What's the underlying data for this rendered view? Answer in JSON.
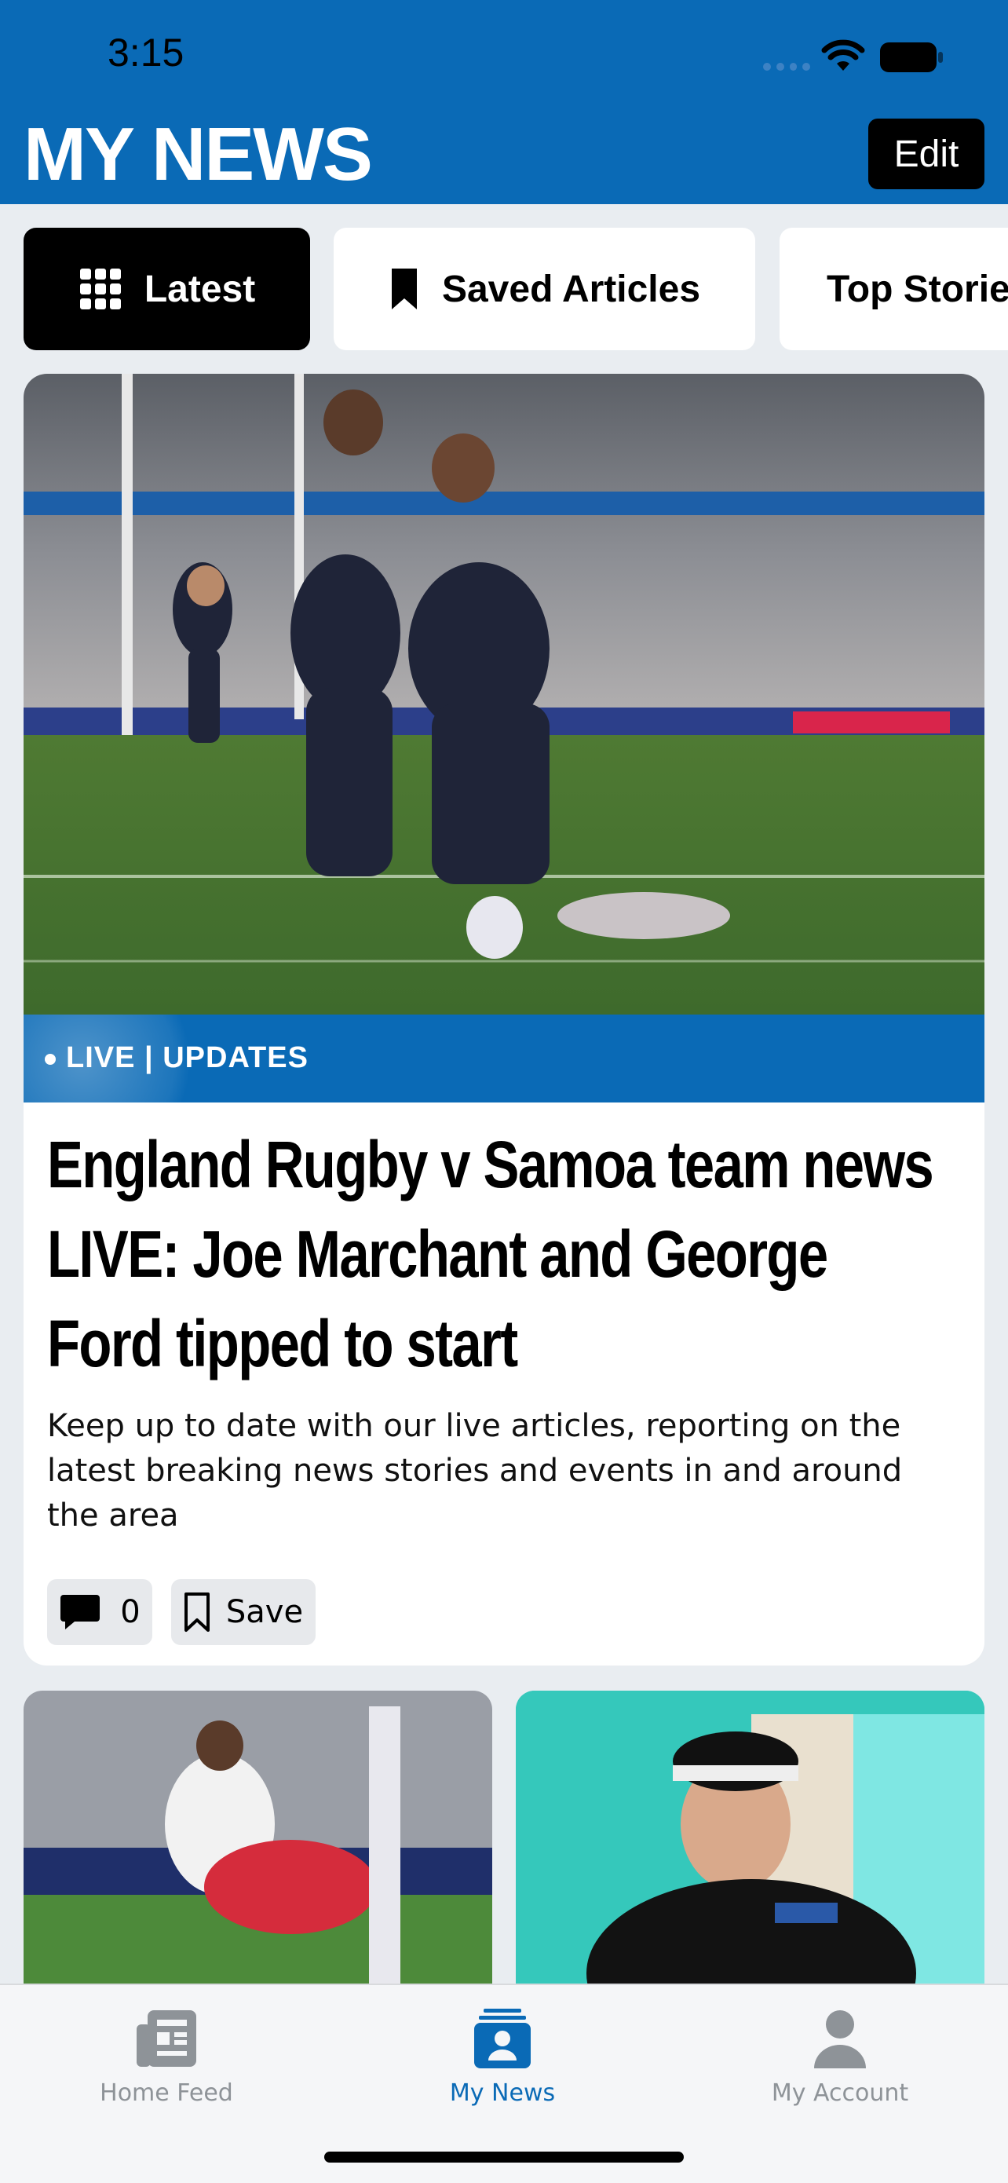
{
  "status_bar": {
    "time": "3:15"
  },
  "header": {
    "title": "MY NEWS",
    "edit_label": "Edit"
  },
  "tabs": [
    {
      "label": "Latest",
      "icon": "grid-icon",
      "active": true
    },
    {
      "label": "Saved Articles",
      "icon": "bookmark-icon",
      "active": false
    },
    {
      "label": "Top Stories",
      "icon": "",
      "active": false
    }
  ],
  "featured": {
    "live_label": "LIVE | UPDATES",
    "headline": "England Rugby v Samoa team news LIVE: Joe Marchant and George Ford tipped to start",
    "summary": "Keep up to date with our live articles, reporting on the latest breaking news stories and events in and around the area",
    "comment_count": "0",
    "save_label": "Save"
  },
  "tabbar": {
    "items": [
      {
        "label": "Home Feed",
        "icon": "newspaper-icon",
        "active": false
      },
      {
        "label": "My News",
        "icon": "my-news-icon",
        "active": true
      },
      {
        "label": "My Account",
        "icon": "person-icon",
        "active": false
      }
    ]
  },
  "colors": {
    "brand_blue": "#0a6ab6",
    "active_tab": "#000000"
  }
}
